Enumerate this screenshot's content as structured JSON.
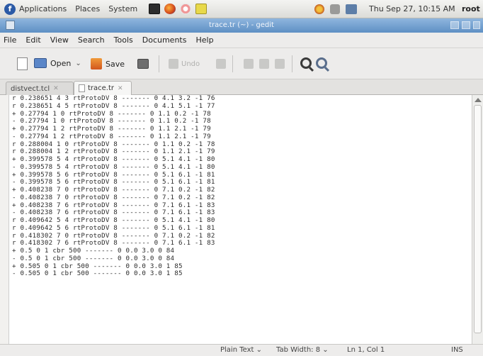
{
  "panel": {
    "menus": [
      "Applications",
      "Places",
      "System"
    ],
    "clock": "Thu Sep 27, 10:15 AM",
    "user": "root"
  },
  "window": {
    "title": "trace.tr (~) - gedit"
  },
  "menubar": [
    "File",
    "Edit",
    "View",
    "Search",
    "Tools",
    "Documents",
    "Help"
  ],
  "toolbar": {
    "open_label": "Open",
    "open_arrow": "⌄",
    "save_label": "Save",
    "undo_label": "Undo"
  },
  "tabs": [
    {
      "label": "distvect.tcl",
      "close": "✕"
    },
    {
      "label": "trace.tr",
      "close": "✕"
    }
  ],
  "editor_lines": [
    "r 0.238651 4 3 rtProtoDV 8 ------- 0 4.1 3.2 -1 76",
    "r 0.238651 4 5 rtProtoDV 8 ------- 0 4.1 5.1 -1 77",
    "+ 0.27794 1 0 rtProtoDV 8 ------- 0 1.1 0.2 -1 78",
    "- 0.27794 1 0 rtProtoDV 8 ------- 0 1.1 0.2 -1 78",
    "+ 0.27794 1 2 rtProtoDV 8 ------- 0 1.1 2.1 -1 79",
    "- 0.27794 1 2 rtProtoDV 8 ------- 0 1.1 2.1 -1 79",
    "r 0.288004 1 0 rtProtoDV 8 ------- 0 1.1 0.2 -1 78",
    "r 0.288004 1 2 rtProtoDV 8 ------- 0 1.1 2.1 -1 79",
    "+ 0.399578 5 4 rtProtoDV 8 ------- 0 5.1 4.1 -1 80",
    "- 0.399578 5 4 rtProtoDV 8 ------- 0 5.1 4.1 -1 80",
    "+ 0.399578 5 6 rtProtoDV 8 ------- 0 5.1 6.1 -1 81",
    "- 0.399578 5 6 rtProtoDV 8 ------- 0 5.1 6.1 -1 81",
    "+ 0.408238 7 0 rtProtoDV 8 ------- 0 7.1 0.2 -1 82",
    "- 0.408238 7 0 rtProtoDV 8 ------- 0 7.1 0.2 -1 82",
    "+ 0.408238 7 6 rtProtoDV 8 ------- 0 7.1 6.1 -1 83",
    "- 0.408238 7 6 rtProtoDV 8 ------- 0 7.1 6.1 -1 83",
    "r 0.409642 5 4 rtProtoDV 8 ------- 0 5.1 4.1 -1 80",
    "r 0.409642 5 6 rtProtoDV 8 ------- 0 5.1 6.1 -1 81",
    "r 0.418302 7 0 rtProtoDV 8 ------- 0 7.1 0.2 -1 82",
    "r 0.418302 7 6 rtProtoDV 8 ------- 0 7.1 6.1 -1 83",
    "+ 0.5 0 1 cbr 500 ------- 0 0.0 3.0 0 84",
    "- 0.5 0 1 cbr 500 ------- 0 0.0 3.0 0 84",
    "+ 0.505 0 1 cbr 500 ------- 0 0.0 3.0 1 85",
    "- 0.505 0 1 cbr 500 ------- 0 0.0 3.0 1 85"
  ],
  "statusbar": {
    "language": "Plain Text ⌄",
    "tab_width": "Tab Width: 8 ⌄",
    "position": "Ln 1, Col 1",
    "mode": "INS"
  }
}
